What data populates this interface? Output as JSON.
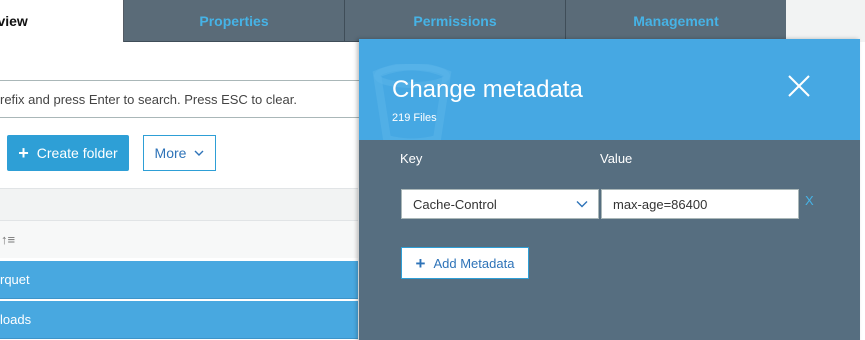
{
  "tabs": [
    {
      "label": "rview"
    },
    {
      "label": "Properties"
    },
    {
      "label": "Permissions"
    },
    {
      "label": "Management"
    }
  ],
  "search": {
    "hint": "refix and press Enter to search. Press ESC to clear."
  },
  "toolbar": {
    "create_folder_label": "Create folder",
    "more_label": "More"
  },
  "list": {
    "sort_glyph": "↑≡",
    "rows": [
      {
        "name": "rquet"
      },
      {
        "name": "loads"
      }
    ]
  },
  "modal": {
    "title": "Change metadata",
    "subtitle": "219 Files",
    "key_header": "Key",
    "value_header": "Value",
    "key_selected": "Cache-Control",
    "value": "max-age=86400",
    "remove_label": "X",
    "add_label": "Add Metadata"
  },
  "icons": {
    "plus": "plus-icon",
    "chevron": "chevron-down-icon",
    "close": "close-icon",
    "sort": "sort-ascending-icon"
  },
  "colors": {
    "accent": "#2e9fd6",
    "modal_header": "#46a8e3",
    "modal_body": "#566e80",
    "tab_dark": "#5a6b78",
    "tab_text": "#46b3e6",
    "row_selected": "#48a8e0"
  }
}
